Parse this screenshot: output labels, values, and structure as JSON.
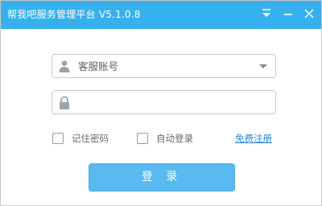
{
  "window": {
    "title": "帮我吧服务管理平台 V5.1.0.8"
  },
  "titlebar": {
    "menu_icon": "dropdown-menu-icon",
    "minimize_icon": "minimize-icon",
    "close_icon": "close-icon"
  },
  "form": {
    "account": {
      "placeholder": "客服账号",
      "value": "",
      "icon": "user-icon",
      "dropdown_icon": "chevron-down-icon"
    },
    "password": {
      "placeholder": "",
      "value": "",
      "icon": "lock-icon"
    },
    "remember_password": {
      "label": "记住密码",
      "checked": false
    },
    "auto_login": {
      "label": "自动登录",
      "checked": false
    },
    "register_link": "免费注册",
    "login_button": "登 录"
  },
  "colors": {
    "titlebar": "#37b1ed",
    "button": "#59b9f0",
    "link": "#2d8ad8",
    "icon": "#9aa4ad"
  }
}
